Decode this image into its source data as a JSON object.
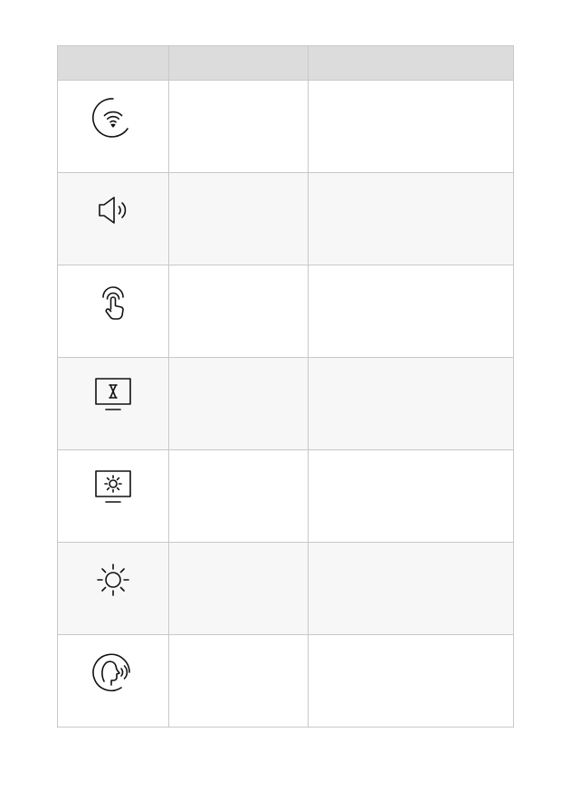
{
  "table": {
    "headers": [
      "",
      "",
      ""
    ],
    "rows": [
      {
        "icon": "wifi-icon",
        "name": "",
        "description": ""
      },
      {
        "icon": "volume-icon",
        "name": "",
        "description": ""
      },
      {
        "icon": "touch-icon",
        "name": "",
        "description": ""
      },
      {
        "icon": "screen-timer-icon",
        "name": "",
        "description": ""
      },
      {
        "icon": "screen-brightness-icon",
        "name": "",
        "description": ""
      },
      {
        "icon": "brightness-icon",
        "name": "",
        "description": ""
      },
      {
        "icon": "voice-icon",
        "name": "",
        "description": ""
      }
    ]
  }
}
